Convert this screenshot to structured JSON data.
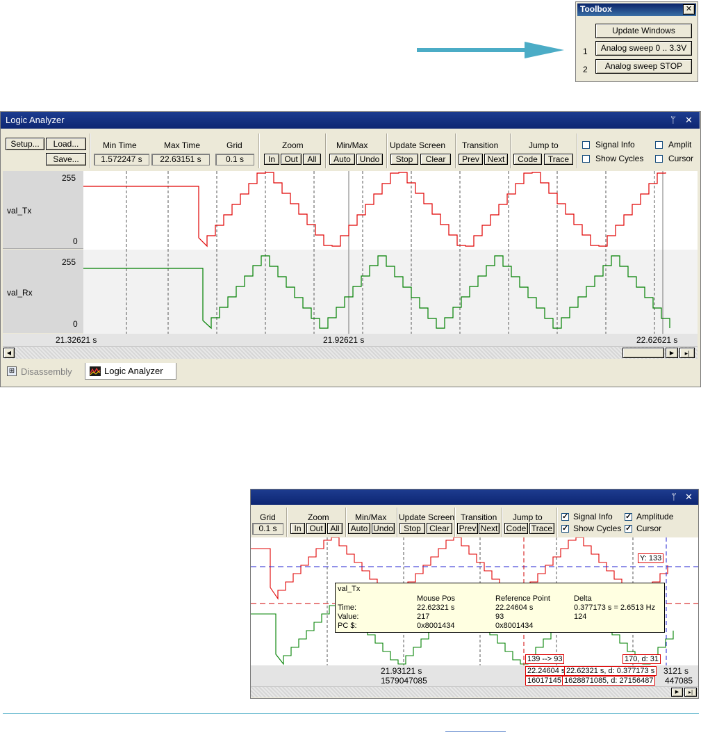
{
  "toolbox": {
    "title": "Toolbox",
    "close": "✕",
    "buttons": [
      {
        "num": "",
        "label": "Update Windows"
      },
      {
        "num": "1",
        "label": "Analog sweep 0 .. 3.3V"
      },
      {
        "num": "2",
        "label": "Analog sweep STOP"
      }
    ]
  },
  "logic_analyzer": {
    "title": "Logic Analyzer",
    "pin": "ᛘ",
    "close": "✕",
    "setup": "Setup...",
    "load": "Load...",
    "save": "Save...",
    "min_time_label": "Min Time",
    "min_time_value": "1.572247 s",
    "max_time_label": "Max Time",
    "max_time_value": "22.63151 s",
    "grid_label": "Grid",
    "grid_value": "0.1 s",
    "zoom_label": "Zoom",
    "zoom_in": "In",
    "zoom_out": "Out",
    "zoom_all": "All",
    "minmax_label": "Min/Max",
    "auto": "Auto",
    "undo": "Undo",
    "update_label": "Update Screen",
    "stop": "Stop",
    "clear": "Clear",
    "transition_label": "Transition",
    "prev": "Prev",
    "next": "Next",
    "jump_label": "Jump to",
    "code": "Code",
    "trace": "Trace",
    "signal_info": "Signal Info",
    "show_cycles": "Show Cycles",
    "amplitude": "Amplit",
    "cursor": "Cursor",
    "signals": [
      {
        "name": "val_Tx",
        "max": "255",
        "min": "0",
        "color": "#e00000"
      },
      {
        "name": "val_Rx",
        "max": "255",
        "min": "0",
        "color": "#008000"
      }
    ],
    "time_left": "21.32621 s",
    "time_mid": "21.92621 s",
    "time_right": "22.62621 s",
    "tabs": [
      {
        "label": "Disassembly"
      },
      {
        "label": "Logic Analyzer"
      }
    ]
  },
  "zoomed": {
    "grid_label": "Grid",
    "grid_value": "0.1 s",
    "zoom_label": "Zoom",
    "zoom_in": "In",
    "zoom_out": "Out",
    "zoom_all": "All",
    "minmax_label": "Min/Max",
    "auto": "Auto",
    "undo": "Undo",
    "update_label": "Update Screen",
    "stop": "Stop",
    "clear": "Clear",
    "transition_label": "Transition",
    "prev": "Prev",
    "next": "Next",
    "jump_label": "Jump to",
    "code": "Code",
    "trace": "Trace",
    "signal_info": "Signal Info",
    "show_cycles": "Show Cycles",
    "amplitude": "Amplitude",
    "cursor": "Cursor",
    "y_label": "Y: 133",
    "tooltip": {
      "name": "val_Tx",
      "col_mouse": "Mouse Pos",
      "col_ref": "Reference Point",
      "col_delta": "Delta",
      "row_time": "Time:",
      "row_value": "Value:",
      "row_pc": "PC $:",
      "mouse_time": "22.62321 s",
      "mouse_value": "217",
      "mouse_pc": "0x8001434",
      "ref_time": "22.24604 s",
      "ref_value": "93",
      "ref_pc": "0x8001434",
      "delta_time": "0.377173 s = 2.6513 Hz",
      "delta_value": "124"
    },
    "trans_left": "139 --> 93",
    "trans_right": "170,  d: 31",
    "time_mid": "21.93121 s",
    "cycles_mid": "1579047085",
    "ref_time_box": "22.24604 s",
    "ref_cycles_box": "16017145",
    "cur_time_box": "22.62321 s,  d: 0.377173 s",
    "cur_cycles_box": "1628871085,  d: 27156487",
    "time_right_frag": "3121 s",
    "cycles_right_frag": "447085"
  }
}
